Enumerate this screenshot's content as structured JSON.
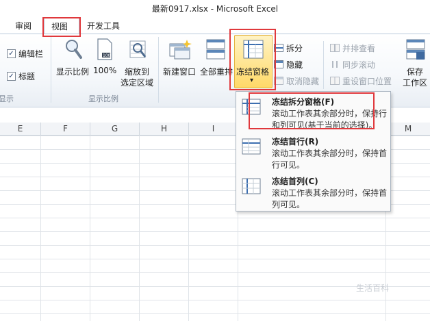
{
  "window": {
    "title": "最新0917.xlsx  -  Microsoft Excel"
  },
  "tabs": [
    {
      "label": "审阅"
    },
    {
      "label": "视图"
    },
    {
      "label": "开发工具"
    }
  ],
  "ribbon": {
    "show_group": {
      "formula_bar_label": "编辑栏",
      "headings_label": "标题",
      "formula_bar_checked": "✓",
      "headings_checked": "✓",
      "group_label": "显示"
    },
    "zoom_group": {
      "zoom_label": "显示比例",
      "hundred_label": "100%",
      "zoom_sel_line1": "缩放到",
      "zoom_sel_line2": "选定区域",
      "group_label": "显示比例"
    },
    "window_group": {
      "new_window_label": "新建窗口",
      "arrange_all_label": "全部重排",
      "freeze_label": "冻结窗格",
      "freeze_arrow": "▾",
      "split_label": "拆分",
      "hide_label": "隐藏",
      "unhide_label": "取消隐藏",
      "side_by_side_label": "并排查看",
      "sync_scroll_label": "同步滚动",
      "reset_pos_label": "重设窗口位置",
      "save_ws_line1": "保存",
      "save_ws_line2": "工作区"
    }
  },
  "columns": [
    "E",
    "F",
    "G",
    "H",
    "I",
    "M"
  ],
  "freeze_menu": [
    {
      "title": "冻结拆分窗格(F)",
      "desc": "滚动工作表其余部分时，保持行和列可见(基于当前的选择)。"
    },
    {
      "title": "冻结首行(R)",
      "desc": "滚动工作表其余部分时，保持首行可见。"
    },
    {
      "title": "冻结首列(C)",
      "desc": "滚动工作表其余部分时，保持首列可见。"
    }
  ],
  "watermark": "生活百科"
}
